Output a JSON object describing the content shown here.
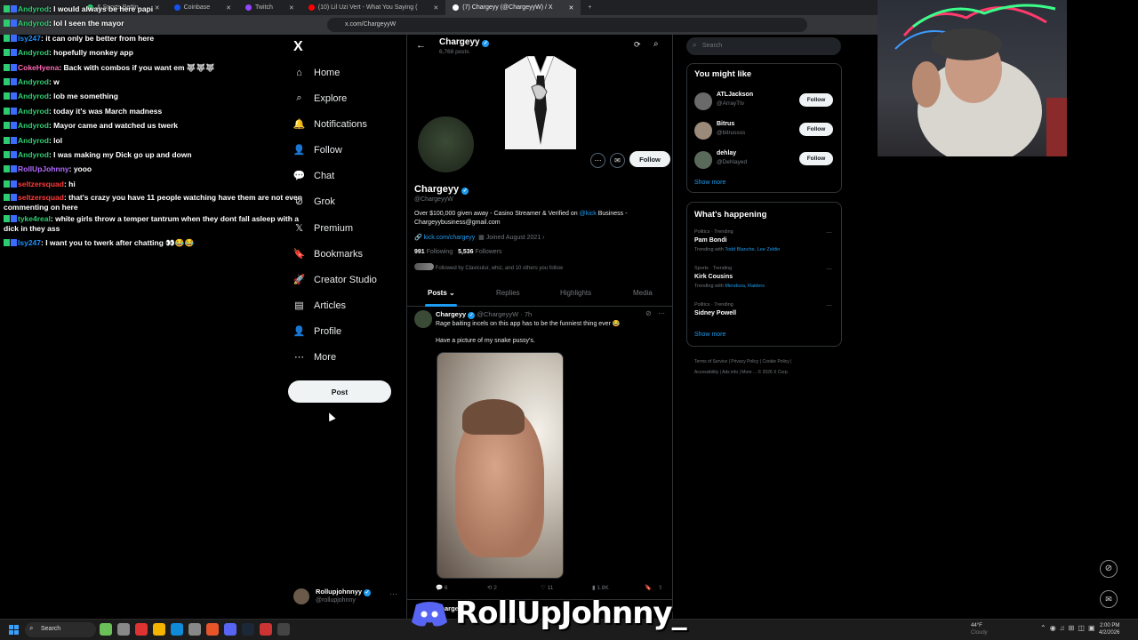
{
  "browser": {
    "tabs": [
      {
        "label": "& Sports Bettin",
        "color": "#2ecc71"
      },
      {
        "label": "Coinbase",
        "color": "#1652f0"
      },
      {
        "label": "Twitch",
        "color": "#9146ff"
      },
      {
        "label": "(10) Lil Uzi Vert - What You Saying (",
        "color": "#ff0000"
      },
      {
        "label": "(7) Chargeyy (@ChargeyyW) / X",
        "color": "#ffffff"
      }
    ],
    "new_tab": "+",
    "url": "x.com/ChargeyyW"
  },
  "chat": [
    {
      "user": "Andyrod",
      "color": "#2ecc71",
      "text": "I would always be here papi"
    },
    {
      "user": "Andyrod",
      "color": "#2ecc71",
      "text": "lol I seen the mayor"
    },
    {
      "user": "lsy247",
      "color": "#1e90ff",
      "text": "it can only be better from here"
    },
    {
      "user": "Andyrod",
      "color": "#2ecc71",
      "text": "hopefully monkey app"
    },
    {
      "user": "CokeHyena",
      "color": "#ff69b4",
      "text": "Back with combos if you want em 🐺🐺🐺"
    },
    {
      "user": "Andyrod",
      "color": "#2ecc71",
      "text": "w"
    },
    {
      "user": "Andyrod",
      "color": "#2ecc71",
      "text": "lob me something"
    },
    {
      "user": "Andyrod",
      "color": "#2ecc71",
      "text": "today it's was March madness"
    },
    {
      "user": "Andyrod",
      "color": "#2ecc71",
      "text": "Mayor came and watched us twerk"
    },
    {
      "user": "Andyrod",
      "color": "#2ecc71",
      "text": "lol"
    },
    {
      "user": "Andyrod",
      "color": "#2ecc71",
      "text": "I was making my Dick go up and down"
    },
    {
      "user": "RollUpJohnny",
      "color": "#b36bff",
      "text": "yooo"
    },
    {
      "user": "seltzersquad",
      "color": "#ff3b3b",
      "text": "hi"
    },
    {
      "user": "seltzersquad",
      "color": "#ff3b3b",
      "text": "that's crazy you have 11 people watching have them are not even commenting on here"
    },
    {
      "user": "tyke4real",
      "color": "#2ecc71",
      "text": "white girls throw a temper tantrum when they dont fall asleep with a dick in they ass"
    },
    {
      "user": "lsy247",
      "color": "#1e90ff",
      "text": "I want you to twerk after chatting 👀😂😂"
    }
  ],
  "nav": {
    "logo": "X",
    "items": [
      {
        "label": "Home",
        "icon": "⌂",
        "name": "home"
      },
      {
        "label": "Explore",
        "icon": "⌕",
        "name": "explore"
      },
      {
        "label": "Notifications",
        "icon": "🔔",
        "name": "notifications"
      },
      {
        "label": "Follow",
        "icon": "👤",
        "name": "follow"
      },
      {
        "label": "Chat",
        "icon": "💬",
        "name": "chat"
      },
      {
        "label": "Grok",
        "icon": "⊘",
        "name": "grok"
      },
      {
        "label": "Premium",
        "icon": "𝕏",
        "name": "premium"
      },
      {
        "label": "Bookmarks",
        "icon": "🔖",
        "name": "bookmarks"
      },
      {
        "label": "Creator Studio",
        "icon": "🚀",
        "name": "creator-studio"
      },
      {
        "label": "Articles",
        "icon": "▤",
        "name": "articles"
      },
      {
        "label": "Profile",
        "icon": "👤",
        "name": "profile"
      },
      {
        "label": "More",
        "icon": "⋯",
        "name": "more"
      }
    ],
    "post": "Post",
    "account": {
      "name": "Rollupjohnnyy",
      "handle": "@rollupjohnny"
    }
  },
  "profile": {
    "header_name": "Chargeyy",
    "post_count": "6,768 posts",
    "name": "Chargeyy",
    "handle": "@ChargeyyW",
    "follow": "Follow",
    "bio_1": "Over $100,000 given away - Casino Streamer & Verified on ",
    "bio_kick": "@kick",
    "bio_2": " Business - Chargeyybusiness@gmail.com",
    "link": "kick.com/chargeyy",
    "joined": "Joined August 2021",
    "following_count": "991",
    "following_label": "Following",
    "followers_count": "5,536",
    "followers_label": "Followers",
    "followed_by": "Followed by Claviculur, whiz, and 10 others you follow",
    "tabs": [
      "Posts",
      "Replies",
      "Highlights",
      "Media"
    ]
  },
  "post": {
    "name": "Chargeyy",
    "meta": "@ChargeyyW · 7h",
    "text_1": "Rage baiting incels on this app has to be the funniest thing ever 😂",
    "text_2": "Have a picture of my snake pussy's.",
    "replies": "6",
    "reposts": "2",
    "likes": "11",
    "views": "1.8K",
    "next_name": "Charge"
  },
  "right": {
    "search_placeholder": "Search",
    "might_like_title": "You might like",
    "suggestions": [
      {
        "name": "ATLJackson",
        "handle": "@ArrayTtv",
        "btn": "Follow"
      },
      {
        "name": "Bitrus",
        "handle": "@bitrussss",
        "btn": "Follow"
      },
      {
        "name": "dehlay",
        "handle": "@Dehlayed",
        "btn": "Follow"
      }
    ],
    "show_more": "Show more",
    "happening_title": "What's happening",
    "trends": [
      {
        "cat": "Politics · Trending",
        "name": "Pam Bondi",
        "sub_prefix": "Trending with ",
        "sub": "Todd Blanche, Lee Zeldin"
      },
      {
        "cat": "Sports · Trending",
        "name": "Kirk Cousins",
        "sub_prefix": "Trending with ",
        "sub": "Mendoza, Raiders"
      },
      {
        "cat": "Politics · Trending",
        "name": "Sidney Powell",
        "sub_prefix": "",
        "sub": ""
      }
    ],
    "show_more_2": "Show more",
    "footer_1": "Terms of Service | Privacy Policy | Cookie Policy |",
    "footer_2": "Accessibility | Ads info | More ... © 2026 X Corp."
  },
  "taskbar": {
    "search": "Search",
    "weather_temp": "44°F",
    "weather_desc": "Cloudy",
    "time": "2:00 PM",
    "date": "4/2/2026"
  },
  "overlay_brand": "RollUpJohnny_"
}
